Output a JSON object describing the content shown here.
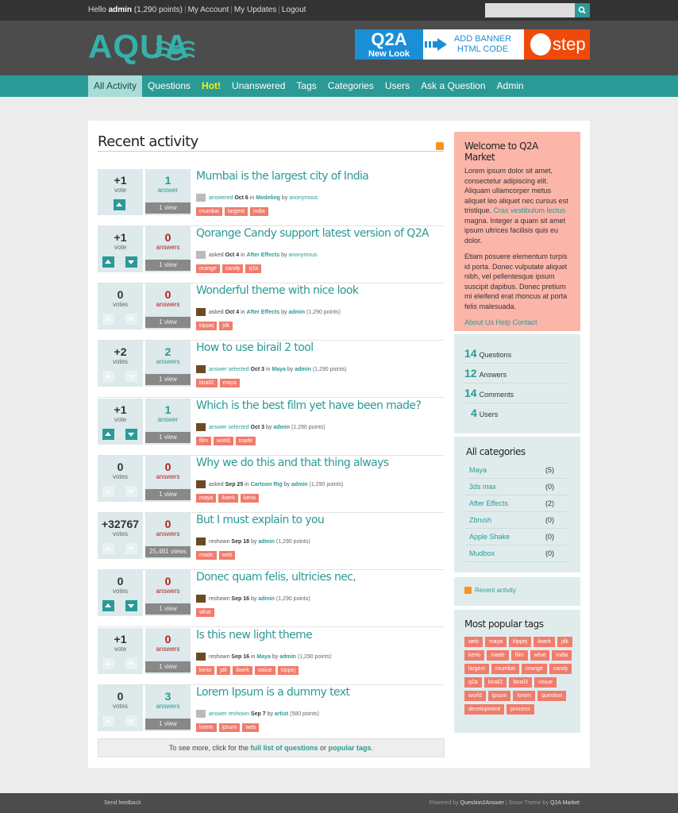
{
  "topbar": {
    "hello": "Hello",
    "username": "admin",
    "points": "(1,290 points)",
    "links": [
      "My Account",
      "My Updates",
      "Logout"
    ],
    "search_placeholder": ""
  },
  "logo": {
    "text": "AQUA"
  },
  "banner": {
    "q2a": "Q2A",
    "new_look": "New Look",
    "line1": "ADD BANNER",
    "line2": "HTML CODE",
    "step": "step"
  },
  "nav": {
    "items": [
      {
        "label": "All Activity",
        "selected": true
      },
      {
        "label": "Questions"
      },
      {
        "label": "Hot!",
        "hot": true
      },
      {
        "label": "Unanswered"
      },
      {
        "label": "Tags"
      },
      {
        "label": "Categories"
      },
      {
        "label": "Users"
      },
      {
        "label": "Ask a Question"
      },
      {
        "label": "Admin"
      }
    ]
  },
  "main": {
    "title": "Recent activity",
    "questions": [
      {
        "votes": "+1",
        "vote_label": "vote",
        "answers": "1",
        "answer_label": "answer",
        "views": "1 view",
        "title": "Mumbai is the largest city of India",
        "what": "answered",
        "when": "Oct 6",
        "in": "in",
        "category": "Modeling",
        "by": "by",
        "who": "anonymous",
        "who_points": "",
        "tags": [
          "mumbai",
          "largest",
          "india"
        ],
        "up": "on",
        "down": "none",
        "avatar": "gray",
        "colored_what": true
      },
      {
        "votes": "+1",
        "vote_label": "vote",
        "answers": "0",
        "answer_label": "answers",
        "views": "1 view",
        "title": "Qorange Candy support latest version of Q2A",
        "what": "asked",
        "when": "Oct 4",
        "in": "in",
        "category": "After Effects",
        "by": "by",
        "who": "anonymous",
        "who_points": "",
        "tags": [
          "orange",
          "candy",
          "q2a"
        ],
        "up": "on",
        "down": "on",
        "avatar": "gray",
        "colored_what": false
      },
      {
        "votes": "0",
        "vote_label": "votes",
        "answers": "0",
        "answer_label": "answers",
        "views": "1 view",
        "title": "Wonderful theme with nice look",
        "what": "asked",
        "when": "Oct 4",
        "in": "in",
        "category": "After Effects",
        "by": "by",
        "who": "admin",
        "who_points": "(1,290 points)",
        "tags": [
          "klppej",
          "jdk"
        ],
        "up": "off",
        "down": "off",
        "avatar": "pic",
        "colored_what": false
      },
      {
        "votes": "+2",
        "vote_label": "votes",
        "answers": "2",
        "answer_label": "answers",
        "views": "1 view",
        "title": "How to use birail 2 tool",
        "what": "answer selected",
        "when": "Oct 3",
        "in": "in",
        "category": "Maya",
        "by": "by",
        "who": "admin",
        "who_points": "(1,290 points)",
        "tags": [
          "birail2",
          "maya"
        ],
        "up": "off",
        "down": "off",
        "avatar": "pic",
        "colored_what": true
      },
      {
        "votes": "+1",
        "vote_label": "vote",
        "answers": "1",
        "answer_label": "answer",
        "views": "1 view",
        "title": "Which is the best film yet have been made?",
        "what": "answer selected",
        "when": "Oct 3",
        "in": "",
        "category": "",
        "by": "by",
        "who": "admin",
        "who_points": "(1,290 points)",
        "tags": [
          "film",
          "world",
          "made"
        ],
        "up": "on",
        "down": "on",
        "avatar": "pic",
        "colored_what": true
      },
      {
        "votes": "0",
        "vote_label": "votes",
        "answers": "0",
        "answer_label": "answers",
        "views": "1 view",
        "title": "Why we do this and that thing always",
        "what": "asked",
        "when": "Sep 25",
        "in": "in",
        "category": "Cartoon Rig",
        "by": "by",
        "who": "admin",
        "who_points": "(1,290 points)",
        "tags": [
          "maya",
          "iloerk",
          "kerio"
        ],
        "up": "off",
        "down": "off",
        "avatar": "pic",
        "colored_what": false
      },
      {
        "votes": "+32767",
        "vote_label": "votes",
        "answers": "0",
        "answer_label": "answers",
        "views": "25,481 views",
        "title": "But I must explain to you",
        "what": "reshown",
        "when": "Sep 18",
        "in": "",
        "category": "",
        "by": "by",
        "who": "admin",
        "who_points": "(1,290 points)",
        "tags": [
          "made",
          "web"
        ],
        "up": "off",
        "down": "off",
        "avatar": "pic",
        "colored_what": false
      },
      {
        "votes": "0",
        "vote_label": "votes",
        "answers": "0",
        "answer_label": "answers",
        "views": "1 view",
        "title": "Donec quam felis, ultricies nec,",
        "what": "reshown",
        "when": "Sep 16",
        "in": "",
        "category": "",
        "by": "by",
        "who": "admin",
        "who_points": "(1,290 points)",
        "tags": [
          "what"
        ],
        "up": "on",
        "down": "on",
        "avatar": "pic",
        "colored_what": false
      },
      {
        "votes": "+1",
        "vote_label": "vote",
        "answers": "0",
        "answer_label": "answers",
        "views": "1 view",
        "title": "Is this new light theme",
        "what": "reshown",
        "when": "Sep 16",
        "in": "in",
        "category": "Maya",
        "by": "by",
        "who": "admin",
        "who_points": "(1,290 points)",
        "tags": [
          "kerio",
          "jdk",
          "iloerk",
          "visiue",
          "klppej"
        ],
        "up": "off",
        "down": "off",
        "avatar": "pic",
        "colored_what": false
      },
      {
        "votes": "0",
        "vote_label": "votes",
        "answers": "3",
        "answer_label": "answers",
        "views": "1 view",
        "title": "Lorem Ipsum is a dummy text",
        "what": "answer reshown",
        "when": "Sep 7",
        "in": "",
        "category": "",
        "by": "by",
        "who": "artist",
        "who_points": "(580 points)",
        "tags": [
          "lorem",
          "ipsum",
          "web"
        ],
        "up": "off",
        "down": "off",
        "avatar": "gray",
        "colored_what": true
      }
    ],
    "more": {
      "prefix": "To see more, click for the",
      "link1": "full list of questions",
      "or": "or",
      "link2": "popular tags",
      "suffix": "."
    }
  },
  "sidebar": {
    "welcome": {
      "title": "Welcome to Q2A Market",
      "p1_a": "Lorem ipsum dolor sit amet, consectetur adipiscing elit. Aliquam ullamcorper metus aliquet leo aliquet nec cursus est tristique.",
      "p1_link": "Cras vestibulum lectus",
      "p1_b": "magna. Integer a quam sit amet ipsum ultrices facilisis quis eu dolor.",
      "p2": "Etiam posuere elementum turpis id porta. Donec vulputate aliquet nibh, vel pellentesque ipsum suscipit dapibus. Donec pretium mi eleifend erat rhoncus at porta felis malesuada.",
      "links": "About Us Help Contact"
    },
    "stats": [
      {
        "num": "14",
        "label": "Questions"
      },
      {
        "num": "12",
        "label": "Answers"
      },
      {
        "num": "14",
        "label": "Comments"
      },
      {
        "num": "4",
        "label": "Users"
      }
    ],
    "categories": {
      "title": "All categories",
      "items": [
        {
          "name": "Maya",
          "count": "(5)"
        },
        {
          "name": "3ds max",
          "count": "(0)"
        },
        {
          "name": "After Effects",
          "count": "(2)"
        },
        {
          "name": "Zbrush",
          "count": "(0)"
        },
        {
          "name": "Apple Shake",
          "count": "(0)"
        },
        {
          "name": "Mudbox",
          "count": "(0)"
        }
      ]
    },
    "feed": {
      "label": "Recent activity"
    },
    "popular_tags": {
      "title": "Most popular tags",
      "tags": [
        "web",
        "maya",
        "klppej",
        "iloerk",
        "jdk",
        "kerio",
        "made",
        "film",
        "what",
        "india",
        "largest",
        "mumbai",
        "orange",
        "candy",
        "q2a",
        "birail2",
        "birail3",
        "visiue",
        "world",
        "ipsum",
        "lorem",
        "question",
        "development",
        "process"
      ]
    }
  },
  "footer": {
    "left": "Send feedback",
    "powered": "Powered by",
    "q2a": "Question2Answer",
    "theme": "| Snow Theme by",
    "market": "Q2A Market"
  },
  "colors": {
    "accent": "#2a9a96",
    "tag": "#f17b6c",
    "welcome_bg": "#fcb5a9",
    "hot": "#ffee00"
  }
}
